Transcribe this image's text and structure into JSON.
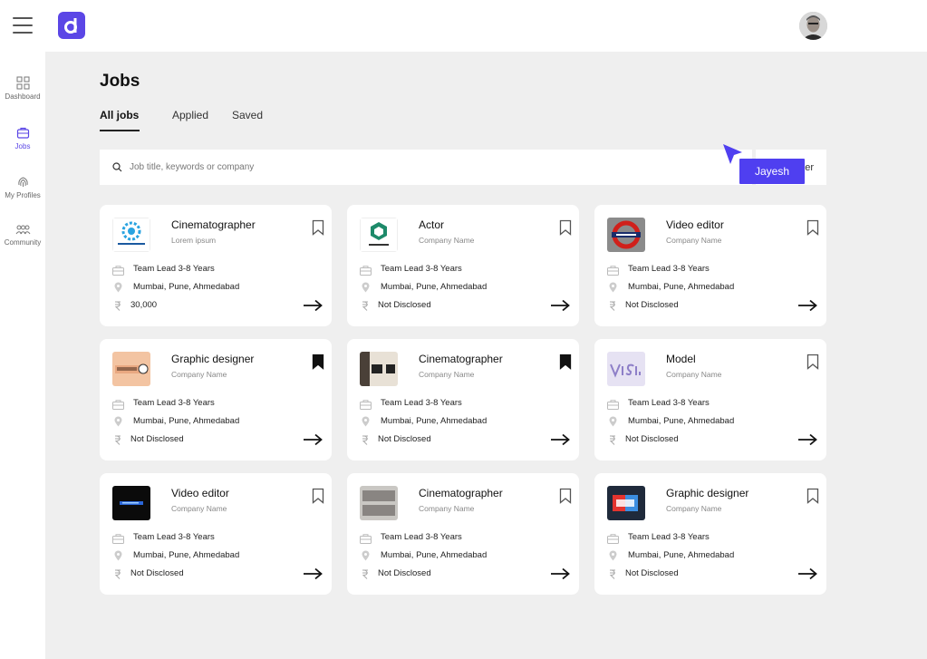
{
  "app": {
    "brand_color": "#5b46e6"
  },
  "sidebar": {
    "items": [
      {
        "label": "Dashboard",
        "icon": "grid-icon"
      },
      {
        "label": "Jobs",
        "icon": "briefcase-icon"
      },
      {
        "label": "My Profiles",
        "icon": "fingerprint-icon"
      },
      {
        "label": "Community",
        "icon": "people-icon"
      }
    ]
  },
  "main": {
    "title": "Jobs",
    "tabs": [
      "All jobs",
      "Applied",
      "Saved"
    ],
    "search_placeholder": "Job title, keywords or company",
    "filter_label": "er",
    "cursor_label": "Jayesh"
  },
  "jobs": [
    {
      "title": "Cinematographer",
      "company": "Lorem ipsum",
      "experience": "Team Lead 3-8 Years",
      "location": "Mumbai, Pune, Ahmedabad",
      "salary": "30,000",
      "saved": false,
      "logo": "cinematography-logo"
    },
    {
      "title": "Actor",
      "company": "Company Name",
      "experience": "Team Lead 3-8 Years",
      "location": "Mumbai, Pune, Ahmedabad",
      "salary": "Not Disclosed",
      "saved": false,
      "logo": "green-hexagon-logo"
    },
    {
      "title": "Video editor",
      "company": "Company Name",
      "experience": "Team Lead 3-8 Years",
      "location": "Mumbai, Pune, Ahmedabad",
      "salary": "Not Disclosed",
      "saved": false,
      "logo": "bond-street-logo"
    },
    {
      "title": "Graphic designer",
      "company": "Company Name",
      "experience": "Team Lead 3-8 Years",
      "location": "Mumbai, Pune, Ahmedabad",
      "salary": "Not Disclosed",
      "saved": true,
      "logo": "stage-logo"
    },
    {
      "title": "Cinematographer",
      "company": "Company Name",
      "experience": "Team Lead 3-8 Years",
      "location": "Mumbai, Pune, Ahmedabad",
      "salary": "Not Disclosed",
      "saved": true,
      "logo": "wba-logo"
    },
    {
      "title": "Model",
      "company": "Company Name",
      "experience": "Team Lead 3-8 Years",
      "location": "Mumbai, Pune, Ahmedabad",
      "salary": "Not Disclosed",
      "saved": false,
      "logo": "visual-logo"
    },
    {
      "title": "Video editor",
      "company": "Company Name",
      "experience": "Team Lead 3-8 Years",
      "location": "Mumbai, Pune, Ahmedabad",
      "salary": "Not Disclosed",
      "saved": false,
      "logo": "dark-logo"
    },
    {
      "title": "Cinematographer",
      "company": "Company Name",
      "experience": "Team Lead 3-8 Years",
      "location": "Mumbai, Pune, Ahmedabad",
      "salary": "Not Disclosed",
      "saved": false,
      "logo": "thirty-three-logo"
    },
    {
      "title": "Graphic designer",
      "company": "Company Name",
      "experience": "Team Lead 3-8 Years",
      "location": "Mumbai, Pune, Ahmedabad",
      "salary": "Not Disclosed",
      "saved": false,
      "logo": "ar-logo"
    }
  ]
}
